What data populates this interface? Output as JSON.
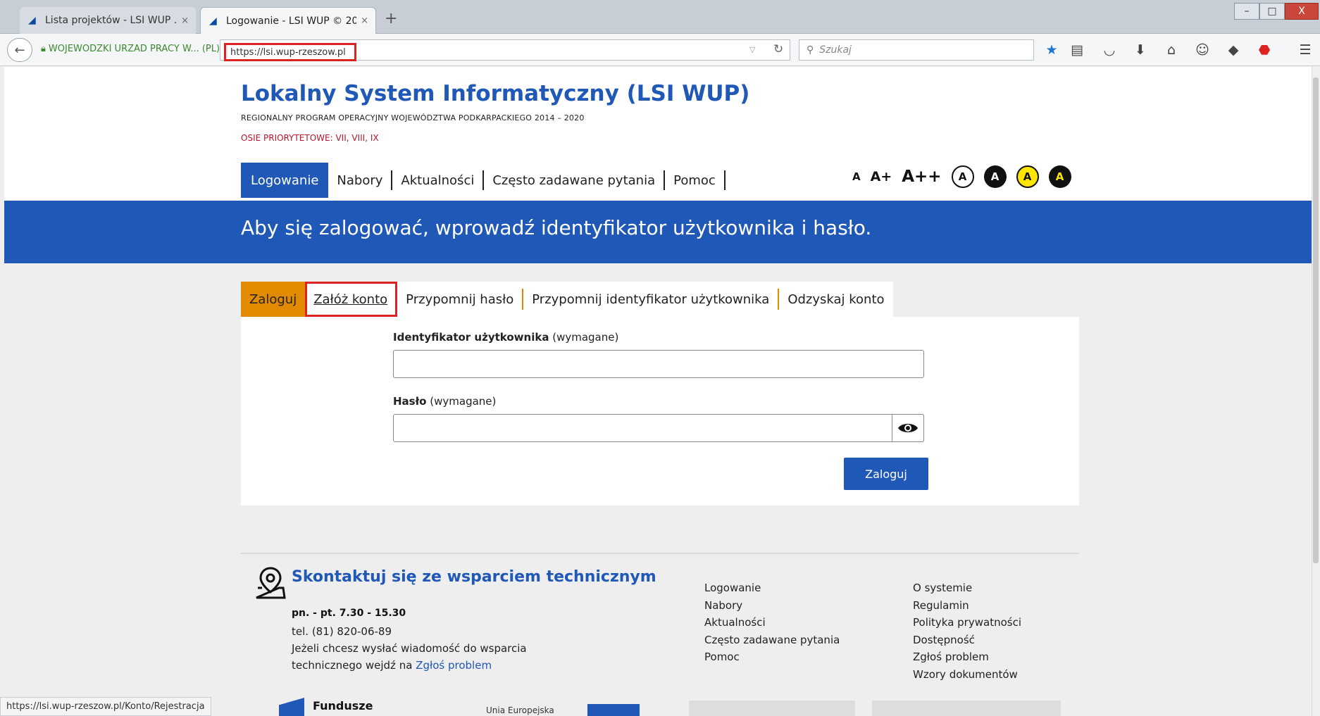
{
  "browser": {
    "tabs": [
      {
        "title": "Lista projektów - LSI WUP ...",
        "active": false
      },
      {
        "title": "Logowanie - LSI WUP © 20...",
        "active": true
      }
    ],
    "close_glyph": "×",
    "new_tab_glyph": "+",
    "identity_label": "WOJEWODZKI URZAD PRACY W... (PL)",
    "url": "https://lsi.wup-rzeszow.pl",
    "search_placeholder": "Szukaj",
    "status_url": "https://lsi.wup-rzeszow.pl/Konto/Rejestracja",
    "window_controls": [
      "–",
      "□",
      "X"
    ]
  },
  "header": {
    "title": "Lokalny System Informatyczny (LSI WUP)",
    "subtitle": "REGIONALNY PROGRAM OPERACYJNY WOJEWÓDZTWA PODKARPACKIEGO 2014 – 2020",
    "axes": "OSIE PRIORYTETOWE: VII, VIII, IX"
  },
  "nav": {
    "items": [
      "Logowanie",
      "Nabory",
      "Aktualności",
      "Często zadawane pytania",
      "Pomoc"
    ],
    "active_index": 0
  },
  "accessibility": {
    "font_sizes": [
      "A",
      "A+",
      "A++"
    ],
    "contrast_letter": "A"
  },
  "banner": {
    "text": "Aby się zalogować, wprowadź identyfikator użytkownika i hasło."
  },
  "login": {
    "tabs": [
      "Zaloguj",
      "Załóż konto",
      "Przypomnij hasło",
      "Przypomnij identyfikator użytkownika",
      "Odzyskaj konto"
    ],
    "user_label": "Identyfikator użytkownika",
    "required_suffix": "(wymagane)",
    "password_label": "Hasło",
    "user_value": "",
    "password_value": "",
    "submit_label": "Zaloguj"
  },
  "footer": {
    "contact_title": "Skontaktuj się ze wsparciem technicznym",
    "hours": "pn. - pt. 7.30 - 15.30",
    "phone": "tel. (81) 820-06-89",
    "support_line1": "Jeżeli chcesz wysłać wiadomość do wsparcia",
    "support_line2_prefix": "technicznego wejdź na",
    "support_link": "Zgłoś problem",
    "links_col1": [
      "Logowanie",
      "Nabory",
      "Aktualności",
      "Często zadawane pytania",
      "Pomoc"
    ],
    "links_col2": [
      "O systemie",
      "Regulamin",
      "Polityka prywatności",
      "Dostępność",
      "Zgłoś problem",
      "Wzory dokumentów"
    ],
    "fund_logo_text": "Fundusze",
    "eu_text": "Unia Europejska"
  },
  "colors": {
    "brand_blue": "#1f58b6",
    "orange": "#e28b00",
    "highlight_red": "#dd2222",
    "subtitle_red": "#b5162a"
  }
}
